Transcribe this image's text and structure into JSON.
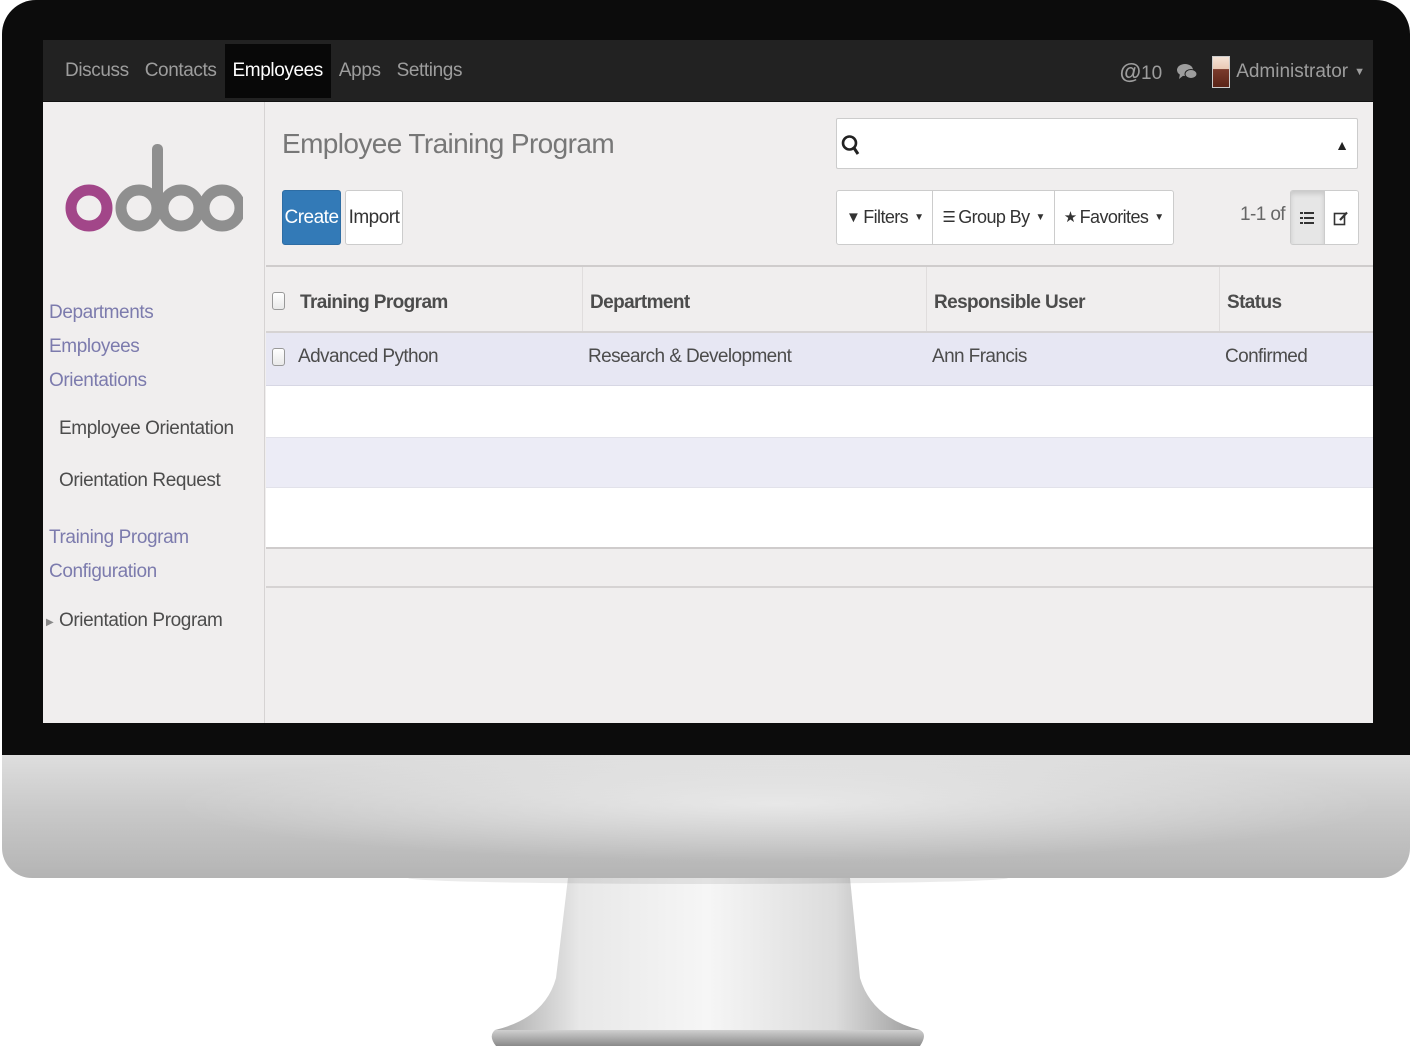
{
  "navbar": {
    "menu": [
      "Discuss",
      "Contacts",
      "Employees",
      "Apps",
      "Settings"
    ],
    "active_index": 2,
    "mentions_count": "10",
    "user_name": "Administrator"
  },
  "sidebar": {
    "logo_text": "odoo",
    "sections": {
      "departments": "Departments",
      "employees": "Employees",
      "orientations": "Orientations",
      "employee_orientation": "Employee Orientation",
      "orientation_request": "Orientation Request",
      "training_program": "Training Program",
      "configuration": "Configuration",
      "orientation_program": "Orientation Program"
    }
  },
  "page": {
    "title": "Employee Training Program",
    "search_placeholder": "",
    "create_label": "Create",
    "import_label": "Import",
    "filters_label": "Filters",
    "groupby_label": "Group By",
    "favorites_label": "Favorites",
    "pager": "1-1 of 1"
  },
  "table": {
    "columns": [
      "Training Program",
      "Department",
      "Responsible User",
      "Status"
    ],
    "rows": [
      [
        "Advanced Python",
        "Research & Development",
        "Ann Francis",
        "Confirmed"
      ]
    ]
  },
  "colors": {
    "navbar_bg": "#222222",
    "accent": "#337ab7",
    "sidebar_link": "#7c7bad",
    "logo_o": "#a24689",
    "logo_doo": "#8f8f8f"
  }
}
